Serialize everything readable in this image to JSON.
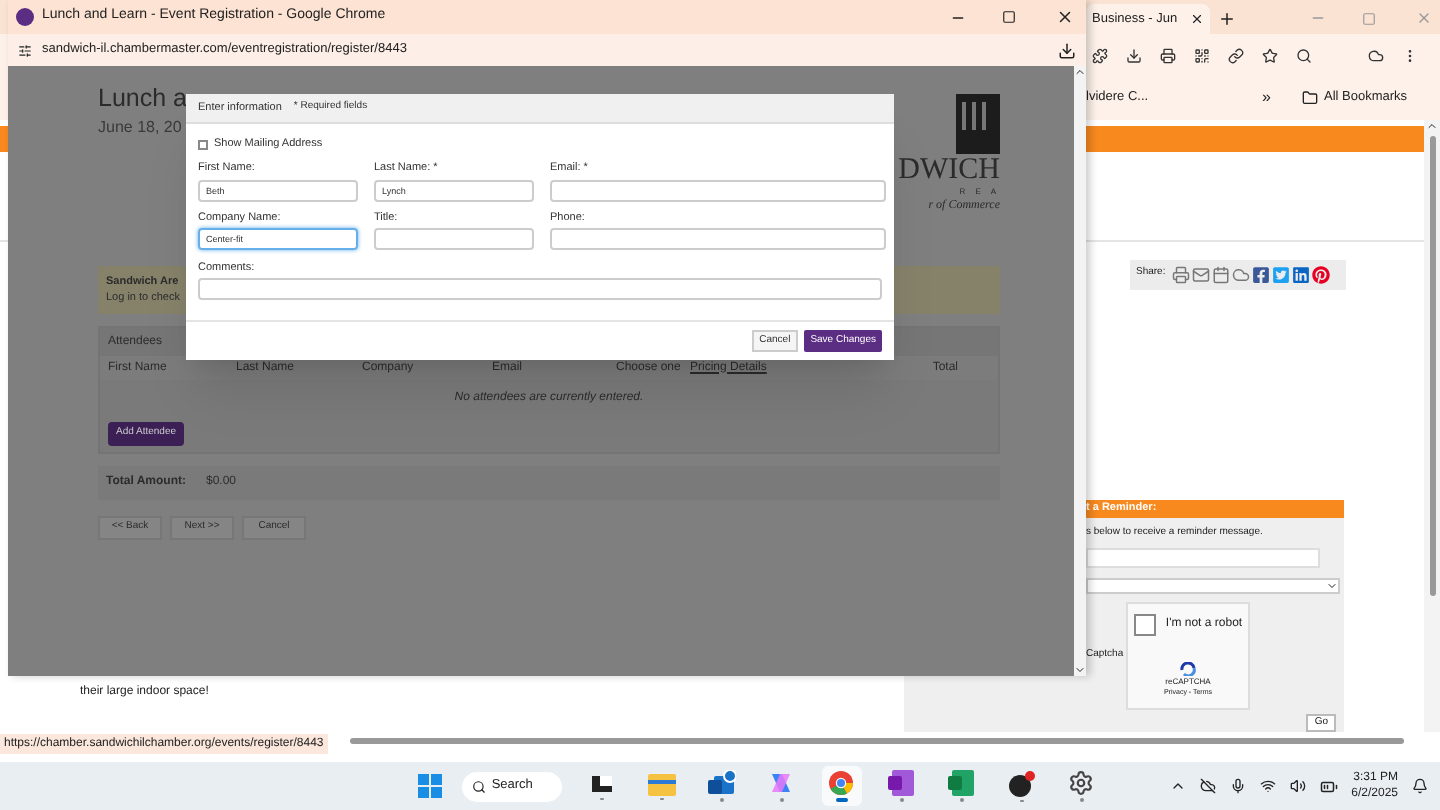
{
  "background_window": {
    "tabs": [
      {
        "label": "Business - Jun",
        "selected": true
      }
    ],
    "bookmarks": [
      {
        "label": "lvidere C..."
      }
    ],
    "bookmarks_overflow": "»",
    "all_bookmarks": "All Bookmarks",
    "share_label": "Share:",
    "page_fragment": "their large indoor space!",
    "reminder": {
      "title": "t a Reminder:",
      "instructions": "s below to receive a reminder message.",
      "captcha_label": "Captcha",
      "captcha": {
        "checked": false,
        "label": "I'm not a robot",
        "brand": "reCAPTCHA",
        "links": "Privacy - Terms"
      },
      "go_button": "Go"
    }
  },
  "popup_window": {
    "title": "Lunch and Learn - Event Registration - Google Chrome",
    "url": "sandwich-il.chambermaster.com/eventregistration/register/8443",
    "page": {
      "title": "Lunch a",
      "date": "June 18, 20",
      "logo": {
        "name": "DWICH",
        "area": "R E A",
        "tagline": "r of Commerce"
      },
      "notice": {
        "title": "Sandwich Are",
        "text": "Log in to check"
      },
      "attendees": {
        "title": "Attendees",
        "columns": [
          {
            "label": "First Name",
            "kind": "text"
          },
          {
            "label": "Last Name",
            "kind": "text"
          },
          {
            "label": "Company",
            "kind": "text"
          },
          {
            "label": "Email",
            "kind": "text"
          },
          {
            "label": "Choose one",
            "kind": "text"
          },
          {
            "label": "Pricing Details",
            "kind": "link"
          },
          {
            "label": "Total",
            "kind": "text"
          }
        ],
        "empty_message": "No attendees are currently entered.",
        "add_button": "Add Attendee"
      },
      "total": {
        "label": "Total Amount:",
        "value": "$0.00"
      },
      "buttons": [
        "<< Back",
        "Next >>",
        "Cancel"
      ]
    },
    "dialog": {
      "title": "Enter information",
      "required_note": "* Required fields",
      "checkbox": {
        "label": "Show Mailing Address",
        "checked": false
      },
      "fields": [
        {
          "label": "First Name:",
          "value": "Beth",
          "focused": false
        },
        {
          "label": "Last Name: *",
          "value": "Lynch",
          "focused": false
        },
        {
          "label": "Email: *",
          "focused": false
        },
        {
          "label": "Company Name:",
          "value": "Center-fit",
          "focused": true
        },
        {
          "label": "Title:",
          "focused": false
        },
        {
          "label": "Phone:",
          "focused": false
        }
      ],
      "comments_label": "Comments:",
      "cancel_button": "Cancel",
      "save_button": "Save Changes"
    }
  },
  "status_url": "https://chamber.sandwichilchamber.org/events/register/8443",
  "taskbar": {
    "search": "Search",
    "apps": [
      {
        "kind": "taskview",
        "selected": false
      },
      {
        "kind": "explorer",
        "selected": false
      },
      {
        "kind": "outlook",
        "selected": false
      },
      {
        "kind": "copilot",
        "selected": false
      },
      {
        "kind": "chrome",
        "selected": true
      },
      {
        "kind": "onenote",
        "selected": false
      },
      {
        "kind": "excel",
        "selected": false
      },
      {
        "kind": "app",
        "selected": false
      },
      {
        "kind": "settings",
        "selected": false
      }
    ],
    "time": "3:31 PM",
    "date": "6/2/2025"
  }
}
